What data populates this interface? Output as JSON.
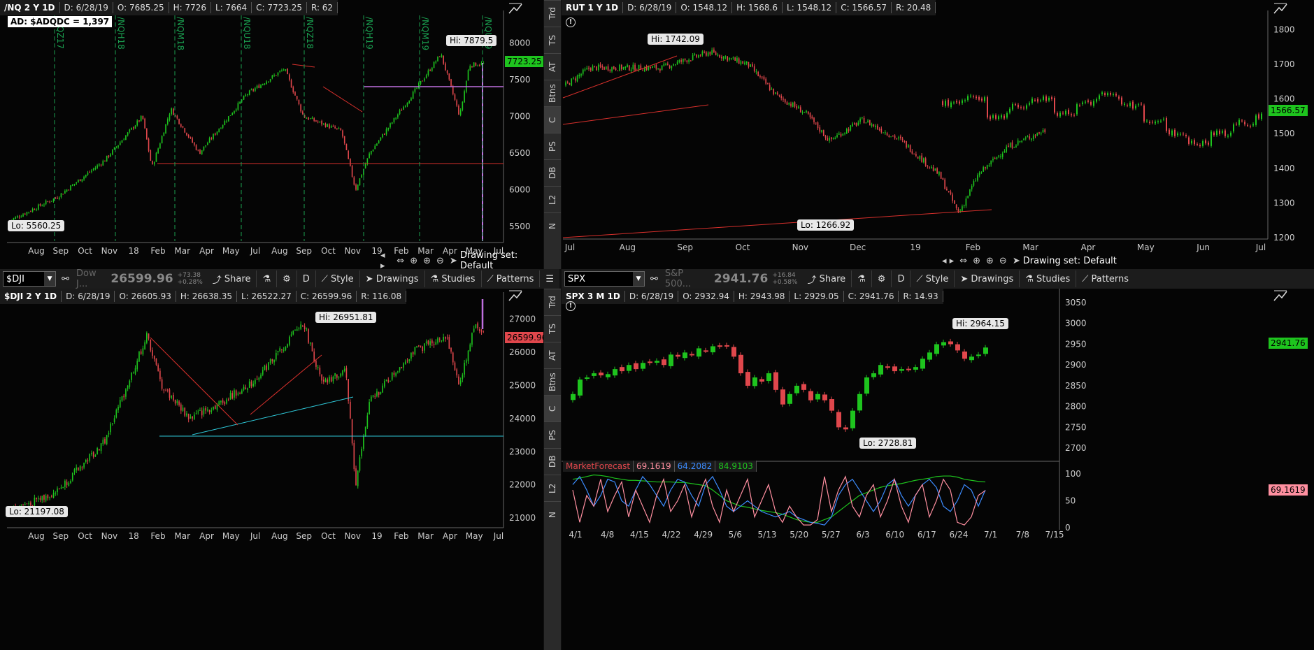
{
  "nq": {
    "info": [
      "/NQ 2 Y 1D",
      "D: 6/28/19",
      "O: 7685.25",
      "H: 7726",
      "L: 7664",
      "C: 7723.25",
      "R: 62"
    ],
    "ad": "AD: $ADQDC = 1,397",
    "hi": "Hi: 7879.5",
    "lo": "Lo: 5560.25",
    "last": "7723.25",
    "yticks": [
      "8000",
      "7500",
      "7000",
      "6500",
      "6000",
      "5500"
    ],
    "xticks": [
      "Aug",
      "Sep",
      "Oct",
      "Nov",
      "18",
      "Feb",
      "Mar",
      "Apr",
      "May",
      "Jul",
      "Aug",
      "Sep",
      "Oct",
      "Nov",
      "19",
      "Feb",
      "Mar",
      "Apr",
      "May",
      "Jul"
    ],
    "rolls": [
      "/NQZ17",
      "/NQH18",
      "/NQM18",
      "/NQU18",
      "/NQZ18",
      "/NQH19",
      "/NQM19",
      "/NQU19"
    ],
    "drawing": "Drawing set: Default"
  },
  "rut": {
    "info": [
      "RUT 1 Y 1D",
      "D: 6/28/19",
      "O: 1548.12",
      "H: 1568.6",
      "L: 1548.12",
      "C: 1566.57",
      "R: 20.48"
    ],
    "hi": "Hi: 1742.09",
    "lo": "Lo: 1266.92",
    "last": "1566.57",
    "yticks": [
      "1800",
      "1700",
      "1600",
      "1500",
      "1400",
      "1300",
      "1200"
    ],
    "xticks": [
      "Jul",
      "Aug",
      "Sep",
      "Oct",
      "Nov",
      "Dec",
      "19",
      "Feb",
      "Mar",
      "Apr",
      "May",
      "Jun",
      "Jul"
    ],
    "drawing": "Drawing set: Default"
  },
  "dji": {
    "symbol": "$DJI",
    "desc": "Dow J...",
    "price": "26599.96",
    "chg1": "+73.38",
    "chg2": "+0.28%",
    "info": [
      "$DJI 2 Y 1D",
      "D: 6/28/19",
      "O: 26605.93",
      "H: 26638.35",
      "L: 26522.27",
      "C: 26599.96",
      "R: 116.08"
    ],
    "hi": "Hi: 26951.81",
    "lo": "Lo: 21197.08",
    "last": "26599.96",
    "yticks": [
      "27000",
      "26000",
      "25000",
      "24000",
      "23000",
      "22000",
      "21000"
    ],
    "xticks": [
      "Aug",
      "Sep",
      "Oct",
      "Nov",
      "18",
      "Feb",
      "Mar",
      "Apr",
      "May",
      "Jul",
      "Aug",
      "Sep",
      "Oct",
      "Nov",
      "19",
      "Feb",
      "Mar",
      "Apr",
      "May",
      "Jul"
    ]
  },
  "spx": {
    "symbol": "SPX",
    "desc": "S&P 500...",
    "price": "2941.76",
    "chg1": "+16.84",
    "chg2": "+0.58%",
    "info": [
      "SPX 3 M 1D",
      "D: 6/28/19",
      "O: 2932.94",
      "H: 2943.98",
      "L: 2929.05",
      "C: 2941.76",
      "R: 14.93"
    ],
    "hi": "Hi: 2964.15",
    "lo": "Lo: 2728.81",
    "last": "2941.76",
    "yticks": [
      "3050",
      "3000",
      "2950",
      "2900",
      "2850",
      "2800",
      "2750",
      "2700"
    ],
    "xticks": [
      "4/1",
      "4/8",
      "4/15",
      "4/22",
      "4/29",
      "5/6",
      "5/13",
      "5/20",
      "5/27",
      "6/3",
      "6/10",
      "6/17",
      "6/24",
      "7/1",
      "7/8",
      "7/15"
    ],
    "mf": {
      "name": "MarketForecast",
      "v1": "69.1619",
      "v2": "64.2082",
      "v3": "84.9103",
      "last": "69.1619",
      "yticks": [
        "100",
        "50",
        "0"
      ]
    }
  },
  "toolbar": {
    "share": "Share",
    "period": "D",
    "style": "Style",
    "drawings": "Drawings",
    "studies": "Studies",
    "patterns": "Patterns"
  },
  "side": [
    "Trd",
    "TS",
    "AT",
    "Btns",
    "C",
    "PS",
    "DB",
    "L2",
    "N"
  ],
  "colors": {
    "up": "#1ec41e",
    "down": "#e0474c",
    "trend": "#d8302c",
    "cyan": "#2ec8d8",
    "violet": "#c070e0"
  }
}
